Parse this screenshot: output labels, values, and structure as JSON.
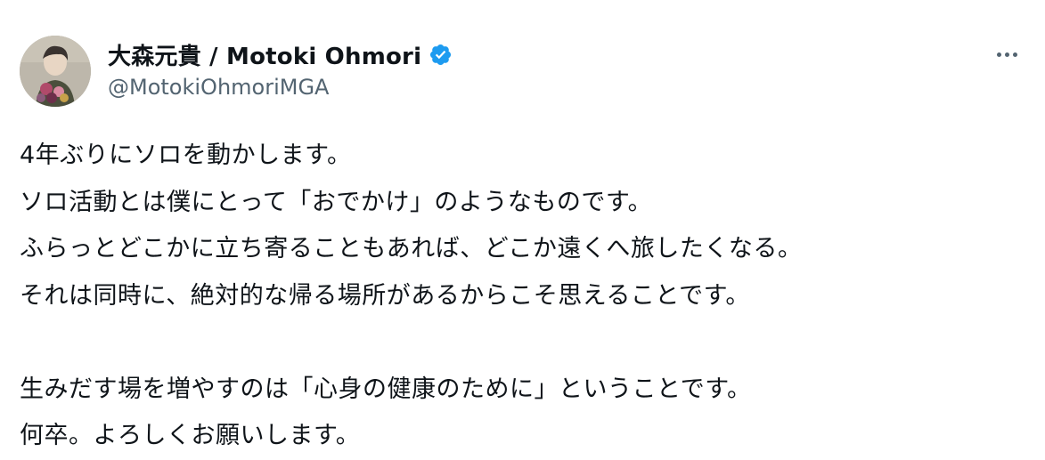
{
  "user": {
    "display_name": "大森元貴 / Motoki Ohmori",
    "handle": "@MotokiOhmoriMGA",
    "verified": true,
    "avatar_icon": "profile-photo"
  },
  "colors": {
    "verified_badge": "#1d9bf0",
    "handle_text": "#536471",
    "body_text": "#0f1419"
  },
  "tweet": {
    "lines": [
      "4年ぶりにソロを動かします。",
      "ソロ活動とは僕にとって「おでかけ」のようなものです。",
      "ふらっとどこかに立ち寄ることもあれば、どこか遠くへ旅したくなる。",
      "それは同時に、絶対的な帰る場所があるからこそ思えることです。",
      "",
      "生みだす場を増やすのは「心身の健康のために」ということです。",
      "何卒。よろしくお願いします。"
    ]
  }
}
